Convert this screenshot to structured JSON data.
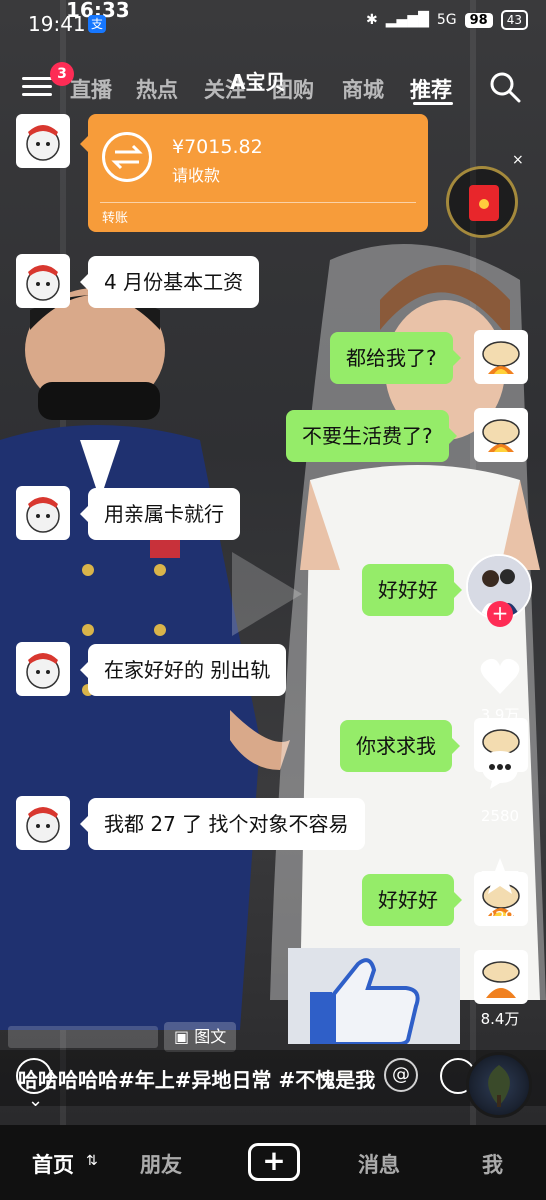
{
  "status_bar": {
    "time": "19:41",
    "time_overlay": "16:33",
    "network": "5G",
    "battery_a": "98",
    "battery_b": "43"
  },
  "top_nav": {
    "badge_count": "3",
    "title": "A宝贝",
    "tabs": [
      {
        "label": "直播"
      },
      {
        "label": "热点"
      },
      {
        "label": "关注"
      },
      {
        "label": "团购"
      },
      {
        "label": "商城"
      },
      {
        "label": "推荐"
      }
    ]
  },
  "chat": {
    "transfer": {
      "amount": "¥7015.82",
      "note": "请收款",
      "kind": "转账"
    },
    "messages": [
      {
        "side": "left",
        "text": "4 月份基本工资"
      },
      {
        "side": "right",
        "text": "都给我了?"
      },
      {
        "side": "right",
        "text": "不要生活费了?"
      },
      {
        "side": "left",
        "text": "用亲属卡就行"
      },
      {
        "side": "right",
        "text": "好好好"
      },
      {
        "side": "left",
        "text": "在家好好的 别出轨"
      },
      {
        "side": "right",
        "text": "你求求我"
      },
      {
        "side": "left",
        "text": "我都 27 了 找个对象不容易"
      },
      {
        "side": "right",
        "text": "好好好"
      }
    ]
  },
  "right_rail": {
    "likes": "3.9万",
    "comments": "2580",
    "favorites": "229",
    "shares": "8.4万"
  },
  "caption": {
    "tag_label": "图文",
    "text": "哈哈哈哈哈#年上#异地日常 #不愧是我"
  },
  "bottom_nav": {
    "items": [
      {
        "label": "首页"
      },
      {
        "label": "朋友"
      },
      {
        "label": "+"
      },
      {
        "label": "消息"
      },
      {
        "label": "我"
      }
    ]
  },
  "colors": {
    "accent": "#fe2c55",
    "wechat_green": "#95ec69",
    "transfer_orange": "#f79c3a"
  }
}
